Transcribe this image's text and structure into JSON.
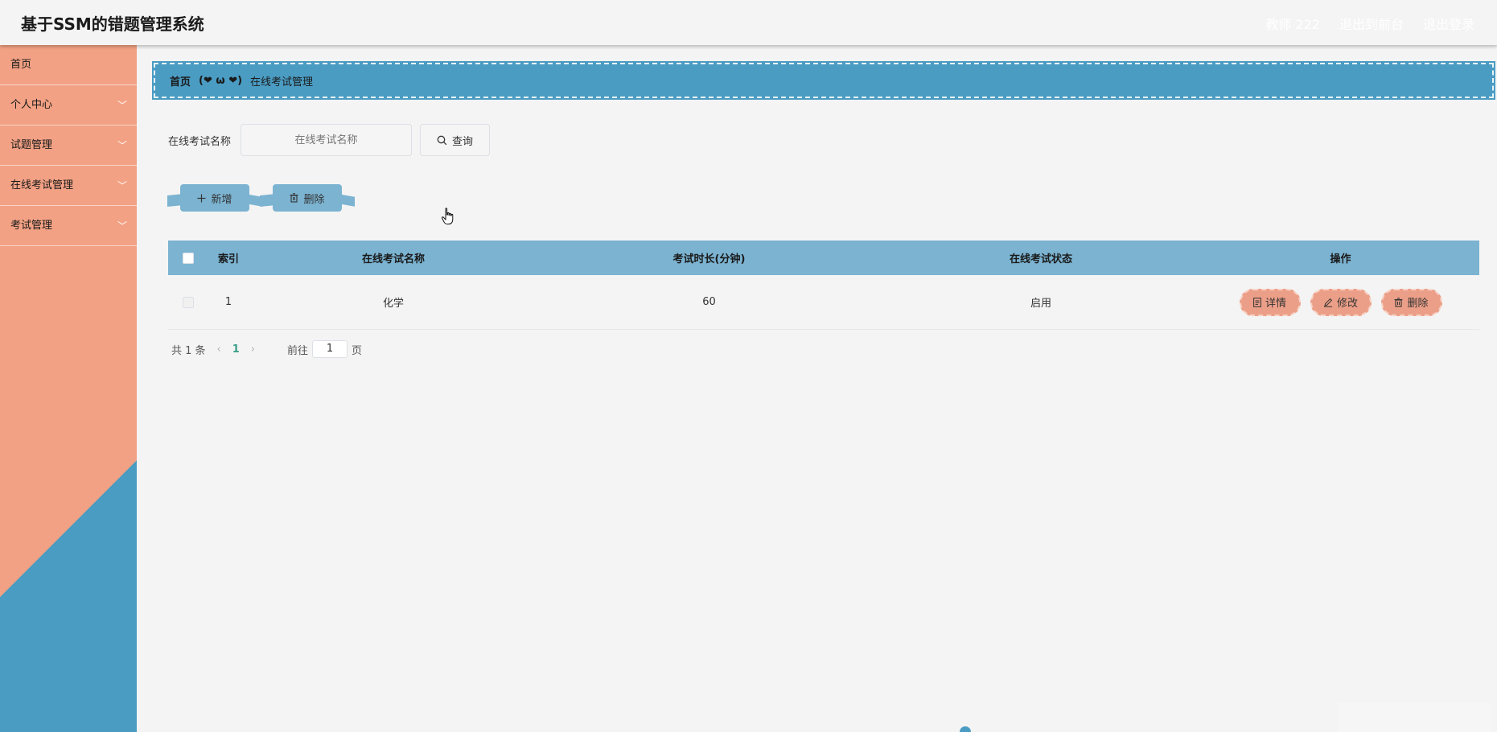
{
  "header": {
    "title": "基于SSM的错题管理系统",
    "user": "教师 222",
    "to_front": "退出到前台",
    "logout": "退出登录"
  },
  "sidebar": {
    "items": [
      {
        "label": "首页",
        "has_children": false
      },
      {
        "label": "个人中心",
        "has_children": true
      },
      {
        "label": "试题管理",
        "has_children": true
      },
      {
        "label": "在线考试管理",
        "has_children": true
      },
      {
        "label": "考试管理",
        "has_children": true
      }
    ]
  },
  "breadcrumb": {
    "home": "首页",
    "separator": "(❤ ω ❤)",
    "current": "在线考试管理"
  },
  "search": {
    "label": "在线考试名称",
    "placeholder": "在线考试名称",
    "button_label": "查询"
  },
  "actions": {
    "add_label": "新增",
    "delete_label": "删除"
  },
  "table": {
    "headers": {
      "index": "索引",
      "name": "在线考试名称",
      "duration": "考试时长(分钟)",
      "status": "在线考试状态",
      "ops": "操作"
    },
    "rows": [
      {
        "index": "1",
        "name": "化学",
        "duration": "60",
        "status": "启用"
      }
    ],
    "row_ops": {
      "detail": "详情",
      "edit": "修改",
      "delete": "删除"
    }
  },
  "pagination": {
    "total": "共 1 条",
    "current_page": "1",
    "goto_label": "前往",
    "goto_value": "1",
    "page_suffix": "页"
  },
  "colors": {
    "salmon": "#f2a184",
    "blue": "#4a9cc3",
    "light_blue": "#7bb3d1",
    "op_button": "#ec9f88",
    "page_active": "#3a9e86"
  }
}
